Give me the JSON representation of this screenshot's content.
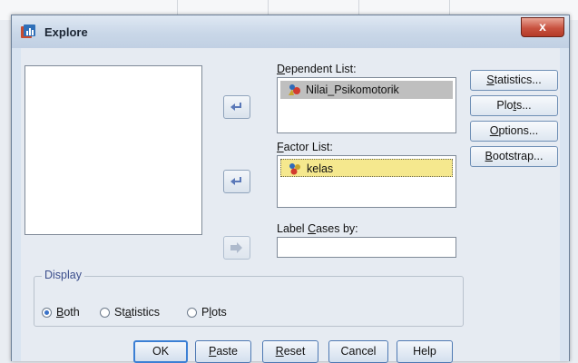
{
  "window": {
    "title": "Explore",
    "close_glyph": "x"
  },
  "variable_list": {
    "items": []
  },
  "dependent_list": {
    "label_pre": "",
    "label_key": "D",
    "label_post": "ependent List:",
    "items": [
      {
        "name": "Nilai_Psikomotorik",
        "icon": "scale-variable-icon",
        "selected": true
      }
    ]
  },
  "factor_list": {
    "label_pre": "",
    "label_key": "F",
    "label_post": "actor List:",
    "items": [
      {
        "name": "kelas",
        "icon": "nominal-variable-icon",
        "focused": true
      }
    ]
  },
  "label_cases": {
    "label_pre": "Label ",
    "label_key": "C",
    "label_post": "ases by:",
    "value": ""
  },
  "side_buttons": {
    "statistics": {
      "pre": "",
      "key": "S",
      "post": "tatistics..."
    },
    "plots": {
      "pre": "Plo",
      "key": "t",
      "post": "s..."
    },
    "options": {
      "pre": "",
      "key": "O",
      "post": "ptions..."
    },
    "bootstrap": {
      "pre": "",
      "key": "B",
      "post": "ootstrap..."
    }
  },
  "display": {
    "legend": "Display",
    "selected": "both",
    "options": {
      "both": {
        "pre": "",
        "key": "B",
        "post": "oth"
      },
      "statistics": {
        "pre": "St",
        "key": "a",
        "post": "tistics"
      },
      "plots": {
        "pre": "P",
        "key": "l",
        "post": "ots"
      }
    }
  },
  "buttons": {
    "ok": {
      "label": "OK"
    },
    "paste": {
      "pre": "",
      "key": "P",
      "post": "aste"
    },
    "reset": {
      "pre": "",
      "key": "R",
      "post": "eset"
    },
    "cancel": {
      "label": "Cancel"
    },
    "help": {
      "label": "Help"
    }
  },
  "colors": {
    "accent_default_button": "#3b7fd4",
    "arrow": "#5a78b8",
    "selected_row": "#bfbfbf",
    "focused_row": "#f5e88e"
  }
}
